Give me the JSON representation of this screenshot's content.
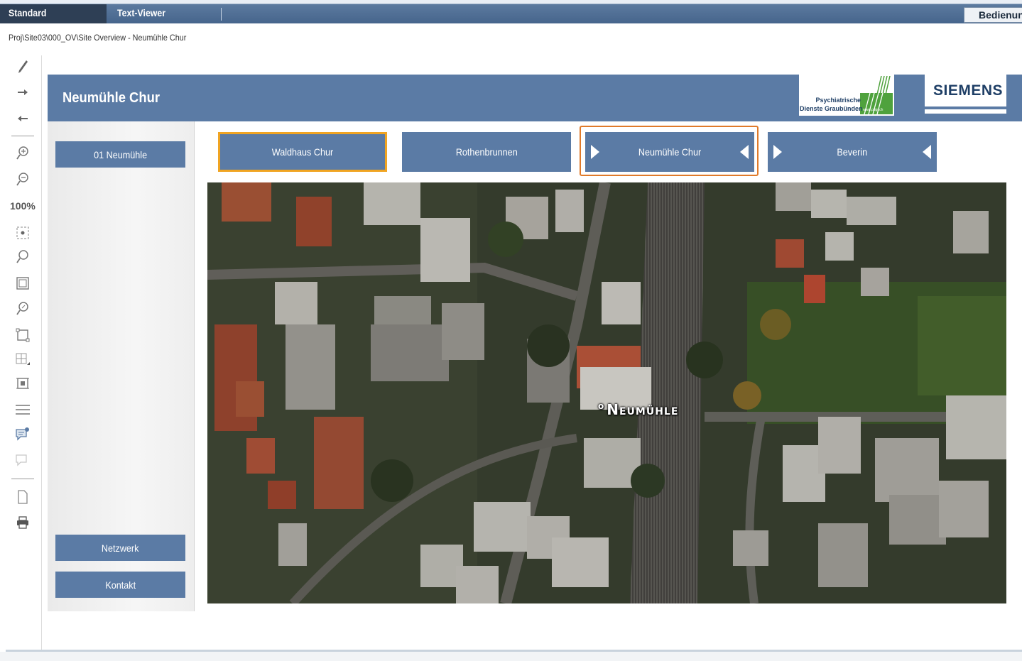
{
  "topbar": {
    "tabs": [
      {
        "label": "Standard"
      },
      {
        "label": "Text-Viewer"
      }
    ],
    "right_button": "Bedienung"
  },
  "breadcrumb": "Proj\\Site03\\000_OV\\Site Overview  -  Neumühle Chur",
  "toolbar": {
    "zoom_level": "100%",
    "icons": [
      "pen-icon",
      "forward-arrow-icon",
      "back-arrow-icon",
      "zoom-in-icon",
      "zoom-out-icon",
      "fit-icon",
      "zoom-search-icon",
      "frame-icon",
      "zoom-rect-icon",
      "area-select-icon",
      "grid-icon",
      "frame-select-icon",
      "menu-icon",
      "comment-icon",
      "comment-disabled-icon",
      "document-icon",
      "print-icon"
    ]
  },
  "header": {
    "title": "Neumühle Chur",
    "logo_pdgr_line1": "Psychiatrische",
    "logo_pdgr_line2": "Dienste Graubünden",
    "logo_pdgr_url": "www.pdgr.ch",
    "logo_siemens": "SIEMENS"
  },
  "sidebar": {
    "items": [
      {
        "label": "01 Neumühle"
      }
    ],
    "bottom_buttons": [
      {
        "label": "Netzwerk"
      },
      {
        "label": "Kontakt"
      }
    ]
  },
  "nav": {
    "buttons": [
      {
        "label": "Waldhaus Chur"
      },
      {
        "label": "Rothenbrunnen"
      },
      {
        "label": "Neumühle Chur"
      },
      {
        "label": "Beverin"
      }
    ]
  },
  "map": {
    "label": "Neumühle",
    "label_marker": "o"
  },
  "colors": {
    "header_blue": "#5b7ba5",
    "highlight_orange": "#f0a422",
    "active_frame": "#e07a2a"
  }
}
